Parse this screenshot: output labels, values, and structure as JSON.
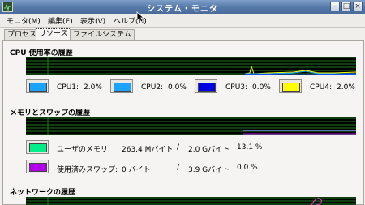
{
  "window": {
    "title": "システム・モニタ"
  },
  "menu": [
    {
      "label": "モニタ(M)"
    },
    {
      "label": "編集(E)"
    },
    {
      "label": "表示(V)"
    },
    {
      "label": "ヘルプ(H)"
    }
  ],
  "tabs": [
    {
      "label": "プロセス",
      "active": false
    },
    {
      "label": "リソース",
      "active": true
    },
    {
      "label": "ファイルシステム",
      "active": false
    }
  ],
  "cpu": {
    "title": "CPU 使用率の履歴",
    "legend": [
      {
        "label": "CPU1:",
        "value": "2.0%",
        "color": "#1aa3ff"
      },
      {
        "label": "CPU2:",
        "value": "0.0%",
        "color": "#1aa3ff"
      },
      {
        "label": "CPU3:",
        "value": "0.0%",
        "color": "#0000e0"
      },
      {
        "label": "CPU4:",
        "value": "2.0%",
        "color": "#ffff00"
      }
    ]
  },
  "memory": {
    "title": "メモリとスワップの履歴",
    "user_memory": {
      "label": "ユーザのメモリ:",
      "used": "263.4 Mバイト",
      "separator": "/",
      "total": "2.0 Gバイト",
      "percent": "13.1 %",
      "color": "#00ee88"
    },
    "swap": {
      "label": "使用済みスワップ:",
      "used": "0 バイト",
      "separator": "/",
      "total": "3.9 Gバイト",
      "percent": "0.0 %",
      "color": "#b000e8"
    }
  },
  "network": {
    "title": "ネットワークの履歴"
  },
  "colors": {
    "graph_bg": "#000000",
    "grid": "#1f7a1f",
    "titlebar": "#5578a8"
  }
}
